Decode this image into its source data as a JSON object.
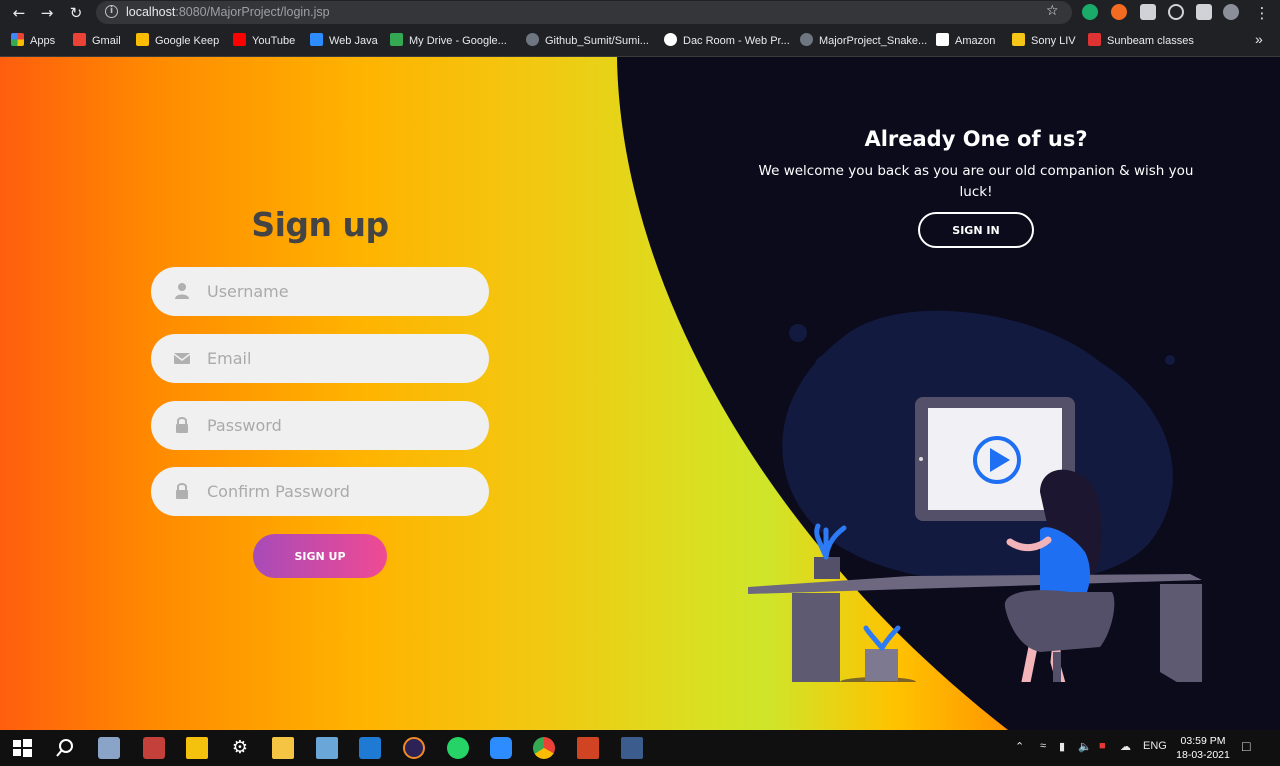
{
  "browser": {
    "url_host": "localhost",
    "url_rest": ":8080/MajorProject/login.jsp",
    "bookmarks": [
      {
        "label": "Apps",
        "color": "#ea4335"
      },
      {
        "label": "Gmail",
        "color": "#ea4335"
      },
      {
        "label": "Google Keep",
        "color": "#fbbc04"
      },
      {
        "label": "YouTube",
        "color": "#ff0000"
      },
      {
        "label": "Web Java",
        "color": "#2d8cff"
      },
      {
        "label": "My Drive - Google...",
        "color": "#34a853"
      },
      {
        "label": "Github_Sumit/Sumi...",
        "color": "#6e7681"
      },
      {
        "label": "Dac Room - Web Pr...",
        "color": "#ffffff"
      },
      {
        "label": "MajorProject_Snake...",
        "color": "#6e7681"
      },
      {
        "label": "Amazon",
        "color": "#ffffff"
      },
      {
        "label": "Sony LIV",
        "color": "#f5c518"
      },
      {
        "label": "Sunbeam classes",
        "color": "#d33"
      }
    ],
    "more": "»"
  },
  "signup": {
    "title": "Sign up",
    "username_placeholder": "Username",
    "email_placeholder": "Email",
    "password_placeholder": "Password",
    "confirm_placeholder": "Confirm Password",
    "button": "SIGN UP"
  },
  "signin_panel": {
    "heading": "Already One of us?",
    "text": "We welcome you back as you are our old companion & wish you luck!",
    "button": "SIGN IN"
  },
  "taskbar": {
    "lang": "ENG",
    "time": "03:59 PM",
    "date": "18-03-2021"
  }
}
